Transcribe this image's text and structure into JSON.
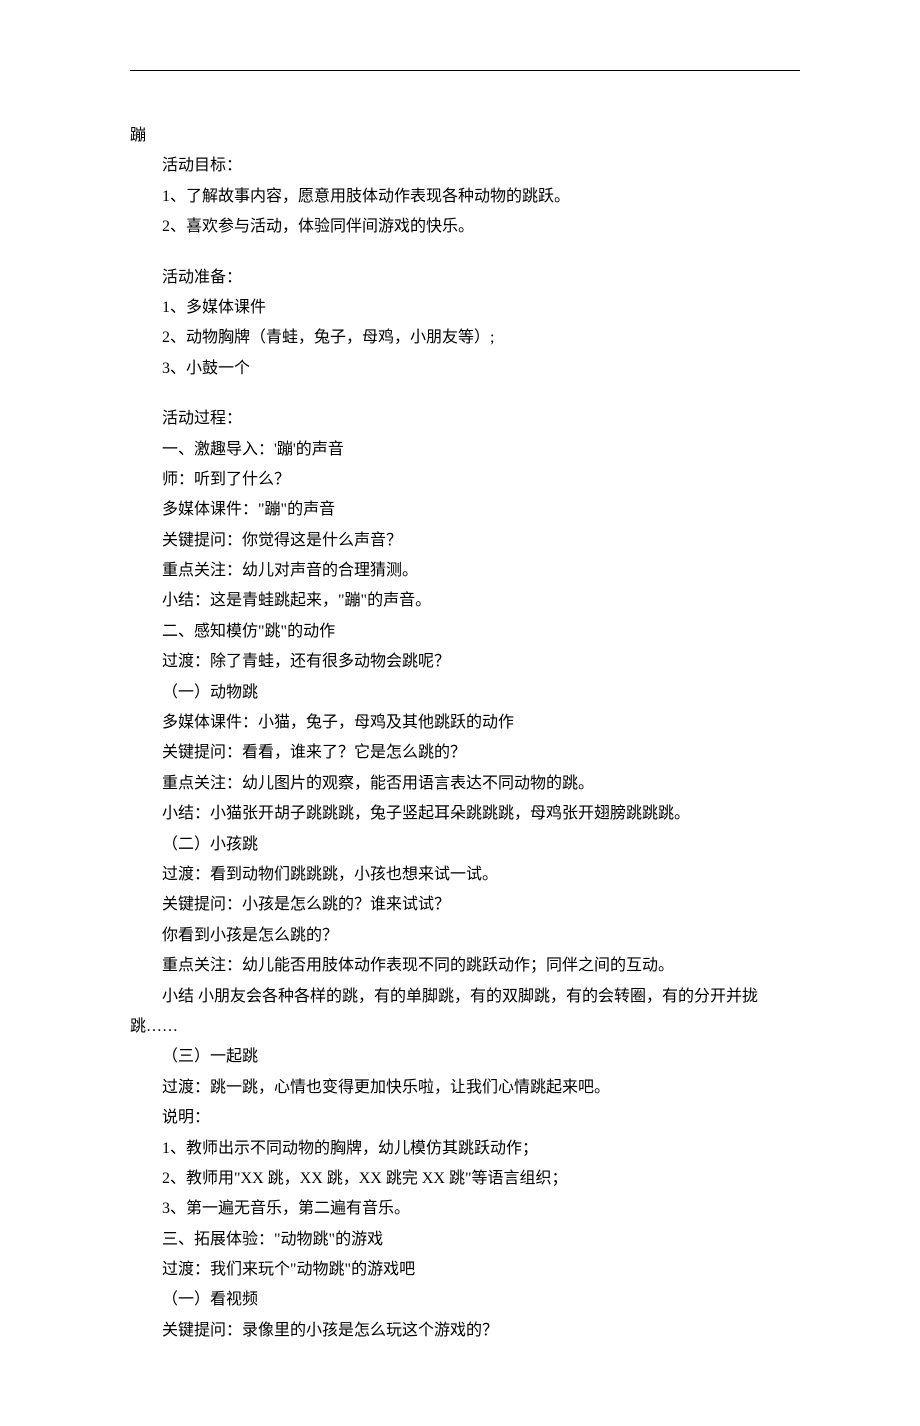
{
  "title": "蹦",
  "sections": {
    "goals": {
      "heading": "活动目标：",
      "items": [
        "1、了解故事内容，愿意用肢体动作表现各种动物的跳跃。",
        "2、喜欢参与活动，体验同伴间游戏的快乐。"
      ]
    },
    "prep": {
      "heading": "活动准备：",
      "items": [
        "1、多媒体课件",
        "2、动物胸牌（青蛙，兔子，母鸡，小朋友等）;",
        "3、小鼓一个"
      ]
    },
    "process": {
      "heading": "活动过程：",
      "lines": [
        "一、激趣导入：'蹦'的声音",
        "师：听到了什么？",
        "多媒体课件：\"蹦\"的声音",
        "关键提问：你觉得这是什么声音？",
        "重点关注：幼儿对声音的合理猜测。",
        "小结：这是青蛙跳起来，\"蹦\"的声音。",
        "二、感知模仿\"跳\"的动作",
        "过渡：除了青蛙，还有很多动物会跳呢？",
        "（一）动物跳",
        "多媒体课件：小猫，兔子，母鸡及其他跳跃的动作",
        "关键提问：看看，谁来了？它是怎么跳的？",
        "重点关注：幼儿图片的观察，能否用语言表达不同动物的跳。",
        "小结：小猫张开胡子跳跳跳，兔子竖起耳朵跳跳跳，母鸡张开翅膀跳跳跳。",
        "（二）小孩跳",
        "过渡：看到动物们跳跳跳，小孩也想来试一试。",
        "关键提问：小孩是怎么跳的？谁来试试？",
        "你看到小孩是怎么跳的？",
        "重点关注：幼儿能否用肢体动作表现不同的跳跃动作；同伴之间的互动。"
      ],
      "summary_hang": "小结 小朋友会各种各样的跳，有的单脚跳，有的双脚跳，有的会转圈，有的分开并拢跳……",
      "lines2": [
        "（三）一起跳",
        "过渡：跳一跳，心情也变得更加快乐啦，让我们心情跳起来吧。",
        "说明：",
        "1、教师出示不同动物的胸牌，幼儿模仿其跳跃动作；",
        "2、教师用\"XX 跳，XX 跳，XX 跳完 XX 跳\"等语言组织；",
        "3、第一遍无音乐，第二遍有音乐。",
        "三、拓展体验：\"动物跳\"的游戏",
        "过渡：我们来玩个\"动物跳\"的游戏吧",
        "（一）看视频",
        "关键提问：录像里的小孩是怎么玩这个游戏的？"
      ]
    }
  }
}
